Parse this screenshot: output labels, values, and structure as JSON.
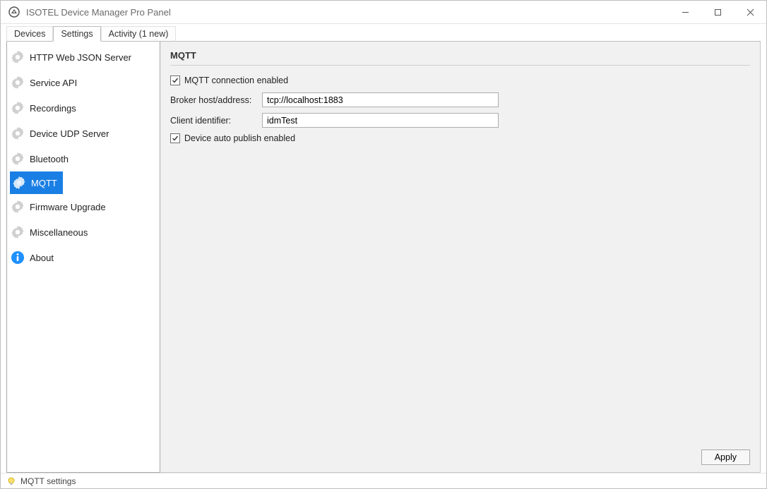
{
  "window": {
    "title": "ISOTEL Device Manager Pro Panel"
  },
  "tabs": [
    {
      "label": "Devices",
      "active": false
    },
    {
      "label": "Settings",
      "active": true
    },
    {
      "label": "Activity (1 new)",
      "active": false
    }
  ],
  "sidebar": {
    "items": [
      {
        "label": "HTTP Web JSON Server",
        "icon": "gear-icon",
        "selected": false
      },
      {
        "label": "Service API",
        "icon": "gear-icon",
        "selected": false
      },
      {
        "label": "Recordings",
        "icon": "gear-icon",
        "selected": false
      },
      {
        "label": "Device UDP Server",
        "icon": "gear-icon",
        "selected": false
      },
      {
        "label": "Bluetooth",
        "icon": "gear-icon",
        "selected": false
      },
      {
        "label": "MQTT",
        "icon": "gear-icon",
        "selected": true
      },
      {
        "label": "Firmware Upgrade",
        "icon": "gear-icon",
        "selected": false
      },
      {
        "label": "Miscellaneous",
        "icon": "gear-icon",
        "selected": false
      },
      {
        "label": "About",
        "icon": "info-icon",
        "selected": false
      }
    ]
  },
  "panel": {
    "heading": "MQTT",
    "conn_enabled_label": "MQTT connection enabled",
    "conn_enabled_checked": true,
    "broker_label": "Broker host/address:",
    "broker_value": "tcp://localhost:1883",
    "client_label": "Client identifier:",
    "client_value": "idmTest",
    "auto_publish_label": "Device auto publish enabled",
    "auto_publish_checked": true,
    "apply_label": "Apply"
  },
  "status": {
    "text": "MQTT settings"
  }
}
